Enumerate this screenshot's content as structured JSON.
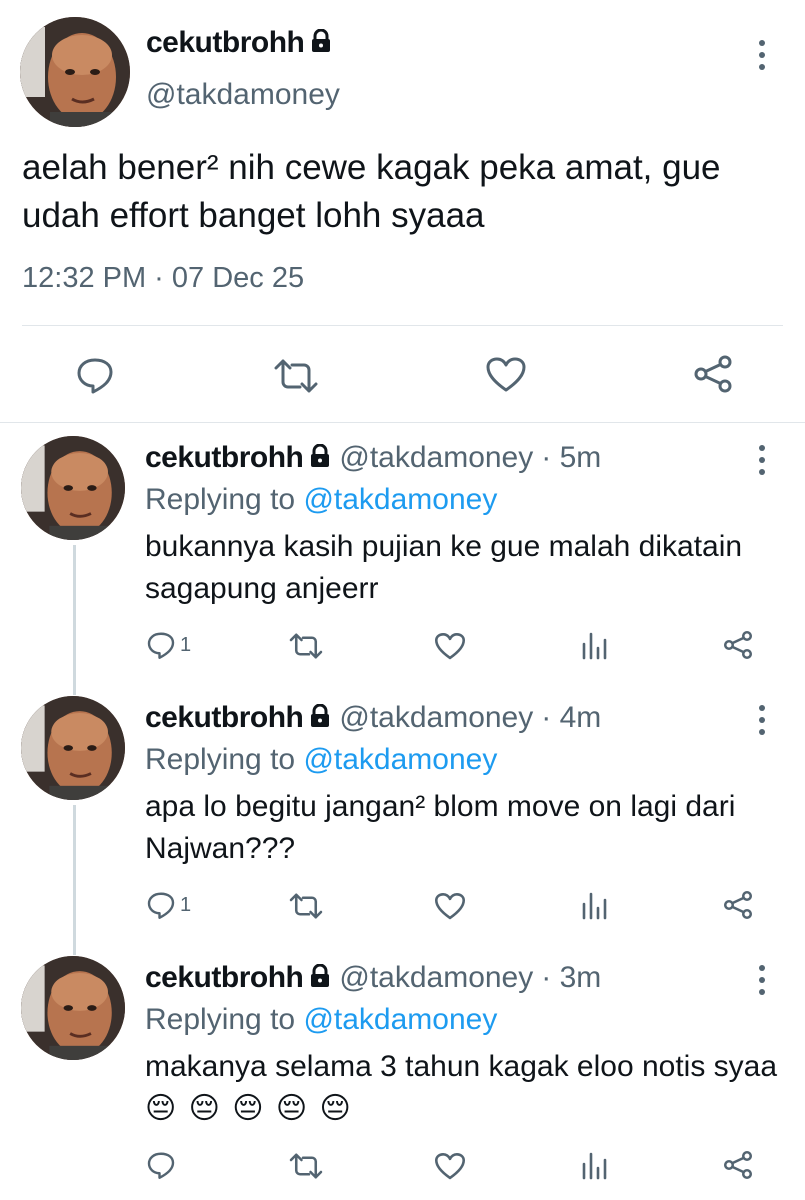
{
  "main_tweet": {
    "name": "cekutbrohh",
    "handle": "@takdamoney",
    "text": "aelah bener² nih cewe kagak peka amat, gue udah effort banget lohh syaaa",
    "timestamp": "12:32 PM · 07 Dec 25"
  },
  "replies": [
    {
      "name": "cekutbrohh",
      "handle": "@takdamoney",
      "time": "· 5m",
      "replying_prefix": "Replying to ",
      "replying_to": "@takdamoney",
      "text": "bukannya kasih pujian ke gue malah dikatain sagapung anjeerr",
      "reply_count": "1"
    },
    {
      "name": "cekutbrohh",
      "handle": "@takdamoney",
      "time": "· 4m",
      "replying_prefix": "Replying to ",
      "replying_to": "@takdamoney",
      "text": "apa lo begitu jangan² blom move on lagi dari Najwan???",
      "reply_count": "1"
    },
    {
      "name": "cekutbrohh",
      "handle": "@takdamoney",
      "time": "· 3m",
      "replying_prefix": "Replying to ",
      "replying_to": "@takdamoney",
      "text": "makanya selama 3 tahun kagak eloo notis syaa",
      "emojis": "😔 😔 😔 😔 😔",
      "reply_count": ""
    }
  ],
  "icons": {
    "reply": "reply-bubble-icon",
    "retweet": "retweet-icon",
    "like": "heart-icon",
    "share": "share-icon",
    "views": "views-bar-icon",
    "more": "more-vertical-icon",
    "lock": "lock-icon"
  },
  "colors": {
    "link": "#1d9bf0",
    "secondary_text": "#536471",
    "primary_text": "#0f1419",
    "divider": "#e1e6ea"
  }
}
